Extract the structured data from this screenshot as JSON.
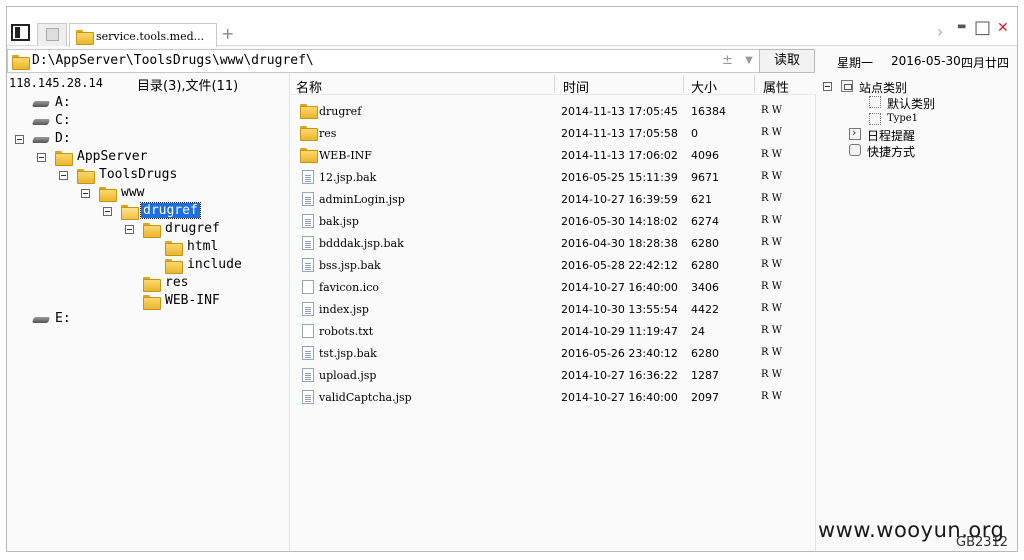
{
  "tabs": [
    {
      "label": "service.tools.med...",
      "active": true
    }
  ],
  "address": {
    "path": "D:\\AppServer\\ToolsDrugs\\www\\drugref\\",
    "plus_minus": "±",
    "dropdown": "▼",
    "read_button": "读取"
  },
  "date": {
    "weekday": "星期一",
    "date": "2016-05-30",
    "lunar": "四月廿四"
  },
  "left": {
    "ip": "118.145.28.14",
    "counts": "目录(3),文件(11)"
  },
  "tree": [
    {
      "label": "A:",
      "type": "drive",
      "level": 0
    },
    {
      "label": "C:",
      "type": "drive",
      "level": 0
    },
    {
      "label": "D:",
      "type": "drive",
      "level": 0,
      "expanded": true
    },
    {
      "label": "AppServer",
      "type": "folder",
      "level": 1,
      "expanded": true
    },
    {
      "label": "ToolsDrugs",
      "type": "folder",
      "level": 2,
      "expanded": true
    },
    {
      "label": "www",
      "type": "folder",
      "level": 3,
      "expanded": true
    },
    {
      "label": "drugref",
      "type": "folder",
      "level": 4,
      "expanded": true,
      "selected": true
    },
    {
      "label": "drugref",
      "type": "folder",
      "level": 5,
      "expanded": true
    },
    {
      "label": "html",
      "type": "folder",
      "level": 6
    },
    {
      "label": "include",
      "type": "folder",
      "level": 6
    },
    {
      "label": "res",
      "type": "folder",
      "level": 5
    },
    {
      "label": "WEB-INF",
      "type": "folder",
      "level": 5
    },
    {
      "label": "E:",
      "type": "drive",
      "level": 0
    }
  ],
  "list_headers": {
    "name": "名称",
    "time": "时间",
    "size": "大小",
    "attr": "属性"
  },
  "files": [
    {
      "name": "drugref",
      "type": "folder",
      "time": "2014-11-13 17:05:45",
      "size": "16384",
      "attr": "R W"
    },
    {
      "name": "res",
      "type": "folder",
      "time": "2014-11-13 17:05:58",
      "size": "0",
      "attr": "R W"
    },
    {
      "name": "WEB-INF",
      "type": "folder",
      "time": "2014-11-13 17:06:02",
      "size": "4096",
      "attr": "R W"
    },
    {
      "name": "12.jsp.bak",
      "type": "file",
      "time": "2016-05-25 15:11:39",
      "size": "9671",
      "attr": "R W"
    },
    {
      "name": "adminLogin.jsp",
      "type": "file",
      "time": "2014-10-27 16:39:59",
      "size": "621",
      "attr": "R W"
    },
    {
      "name": "bak.jsp",
      "type": "file",
      "time": "2016-05-30 14:18:02",
      "size": "6274",
      "attr": "R W"
    },
    {
      "name": "bdddak.jsp.bak",
      "type": "file",
      "time": "2016-04-30 18:28:38",
      "size": "6280",
      "attr": "R W"
    },
    {
      "name": "bss.jsp.bak",
      "type": "file",
      "time": "2016-05-28 22:42:12",
      "size": "6280",
      "attr": "R W"
    },
    {
      "name": "favicon.ico",
      "type": "plain",
      "time": "2014-10-27 16:40:00",
      "size": "3406",
      "attr": "R W"
    },
    {
      "name": "index.jsp",
      "type": "file",
      "time": "2014-10-30 13:55:54",
      "size": "4422",
      "attr": "R W"
    },
    {
      "name": "robots.txt",
      "type": "plain",
      "time": "2014-10-29 11:19:47",
      "size": "24",
      "attr": "R W"
    },
    {
      "name": "tst.jsp.bak",
      "type": "file",
      "time": "2016-05-26 23:40:12",
      "size": "6280",
      "attr": "R W"
    },
    {
      "name": "upload.jsp",
      "type": "file",
      "time": "2014-10-27 16:36:22",
      "size": "1287",
      "attr": "R W"
    },
    {
      "name": "validCaptcha.jsp",
      "type": "file",
      "time": "2014-10-27 16:40:00",
      "size": "2097",
      "attr": "R W"
    }
  ],
  "right": {
    "site_category": "站点类别",
    "default_category": "默认类别",
    "type1": "Type1",
    "schedule": "日程提醒",
    "shortcut": "快捷方式"
  },
  "window_controls": {
    "next": "›",
    "minimize": "▬",
    "maximize": "□",
    "close": "✕"
  },
  "watermark": "www.wooyun.org",
  "encoding": "GB2312",
  "colors": {
    "selection": "#1c6fe0",
    "folder": "#f0c24a",
    "close": "#d62020"
  }
}
